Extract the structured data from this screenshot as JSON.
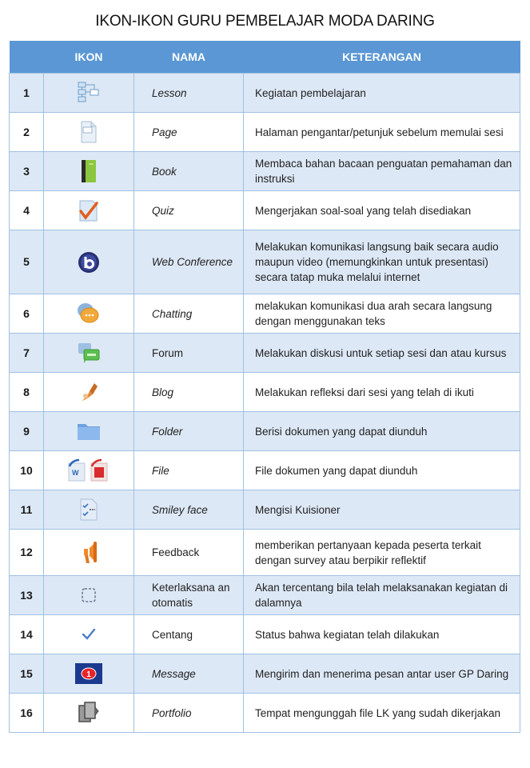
{
  "title": "IKON-IKON GURU PEMBELAJAR MODA DARING",
  "table": {
    "headers": {
      "no": "",
      "icon": "IKON",
      "name": "NAMA",
      "desc": "KETERANGAN"
    },
    "rows": [
      {
        "no": "1",
        "icon": "lesson-icon",
        "name": "Lesson",
        "italic": true,
        "desc": "Kegiatan pembelajaran"
      },
      {
        "no": "2",
        "icon": "page-icon",
        "name": "Page",
        "italic": true,
        "desc": "Halaman pengantar/petunjuk sebelum memulai sesi"
      },
      {
        "no": "3",
        "icon": "book-icon",
        "name": "Book",
        "italic": true,
        "desc": "Membaca bahan bacaan penguatan pemahaman dan instruksi"
      },
      {
        "no": "4",
        "icon": "quiz-icon",
        "name": "Quiz",
        "italic": true,
        "desc": "Mengerjakan soal-soal yang telah disediakan"
      },
      {
        "no": "5",
        "icon": "web-conference-icon",
        "name": "Web Conference",
        "italic": true,
        "desc": "Melakukan komunikasi langsung baik secara audio maupun video (memungkinkan untuk presentasi) secara tatap muka melalui internet"
      },
      {
        "no": "6",
        "icon": "chat-icon",
        "name": "Chatting",
        "italic": true,
        "desc": "melakukan komunikasi dua arah secara langsung dengan menggunakan teks"
      },
      {
        "no": "7",
        "icon": "forum-icon",
        "name": "Forum",
        "italic": false,
        "desc": "Melakukan diskusi untuk setiap sesi dan atau kursus"
      },
      {
        "no": "8",
        "icon": "blog-icon",
        "name": "Blog",
        "italic": true,
        "desc": "Melakukan refleksi dari sesi yang telah di ikuti"
      },
      {
        "no": "9",
        "icon": "folder-icon",
        "name": "Folder",
        "italic": true,
        "desc": "Berisi dokumen yang dapat diunduh"
      },
      {
        "no": "10",
        "icon": "file-icon",
        "name": "File",
        "italic": true,
        "desc": "File dokumen yang dapat diunduh"
      },
      {
        "no": "11",
        "icon": "questionnaire-icon",
        "name": "Smiley face",
        "italic": true,
        "desc": "Mengisi Kuisioner"
      },
      {
        "no": "12",
        "icon": "megaphone-icon",
        "name": "Feedback",
        "italic": false,
        "desc": "memberikan pertanyaan kepada peserta terkait dengan survey atau berpikir reflektif"
      },
      {
        "no": "13",
        "icon": "dashed-checkbox-icon",
        "name": "Keterlaksana an otomatis",
        "italic": false,
        "desc": "Akan tercentang bila telah melaksanakan kegiatan di dalamnya"
      },
      {
        "no": "14",
        "icon": "checkmark-icon",
        "name": "Centang",
        "italic": false,
        "desc": "Status bahwa kegiatan telah dilakukan"
      },
      {
        "no": "15",
        "icon": "message-icon",
        "name": "Message",
        "italic": true,
        "desc": "Mengirim dan menerima pesan  antar user GP Daring"
      },
      {
        "no": "16",
        "icon": "portfolio-icon",
        "name": "Portfolio",
        "italic": true,
        "desc": "Tempat mengunggah file LK yang sudah dikerjakan"
      }
    ]
  },
  "colors": {
    "header_bg": "#5a97d4",
    "row_alt_bg": "#dde8f6",
    "border": "#9fc1e2",
    "message_badge": "#e8232a",
    "message_bg": "#1b3a8f"
  },
  "message_badge_count": "1"
}
